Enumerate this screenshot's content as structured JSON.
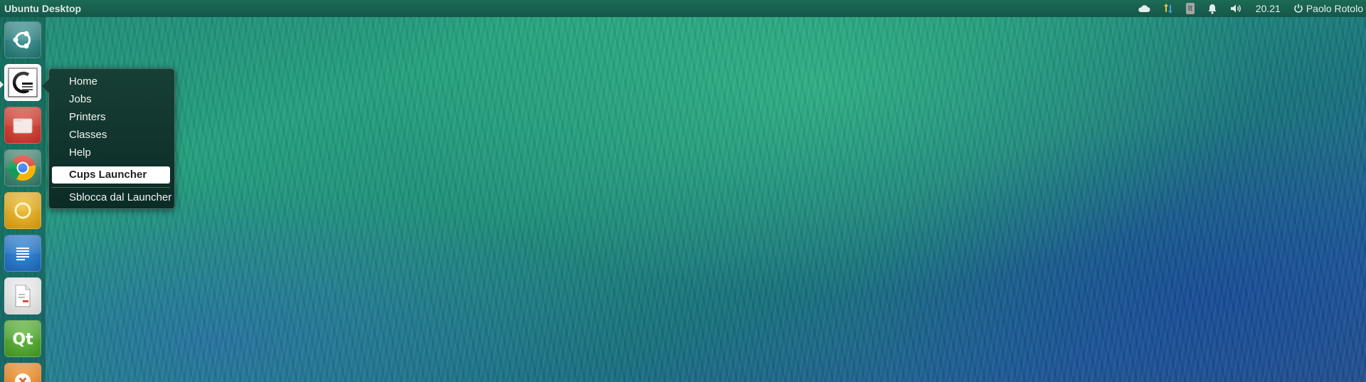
{
  "panel": {
    "title": "Ubuntu Desktop",
    "indicators": {
      "cloud": "cloud-icon",
      "network": "network-transfer-icon",
      "keyboard_layout": "It",
      "notification": "bell-icon",
      "sound": "speaker-icon",
      "clock": "20.21",
      "user": "Paolo Rotolo"
    }
  },
  "launcher": {
    "items": [
      {
        "name": "Dash home",
        "icon": "ubuntu-logo-icon"
      },
      {
        "name": "CUPS",
        "icon": "cups-icon",
        "active": true
      },
      {
        "name": "Files",
        "icon": "files-icon"
      },
      {
        "name": "Chrome",
        "icon": "chrome-icon"
      },
      {
        "name": "Ubuntu One",
        "icon": "circle-yellow-icon"
      },
      {
        "name": "Writer",
        "icon": "writer-icon"
      },
      {
        "name": "Document",
        "icon": "document-icon"
      },
      {
        "name": "Qt Creator",
        "icon": "qt-icon"
      },
      {
        "name": "Close",
        "icon": "close-icon"
      }
    ]
  },
  "quicklist": {
    "items": [
      "Home",
      "Jobs",
      "Printers",
      "Classes",
      "Help"
    ],
    "selected": "Cups Launcher",
    "unlock": "Sblocca dal Launcher"
  },
  "colors": {
    "panel": "#15574a",
    "launcher": "#0c5248",
    "quicklist_bg": "#0c2b26"
  }
}
